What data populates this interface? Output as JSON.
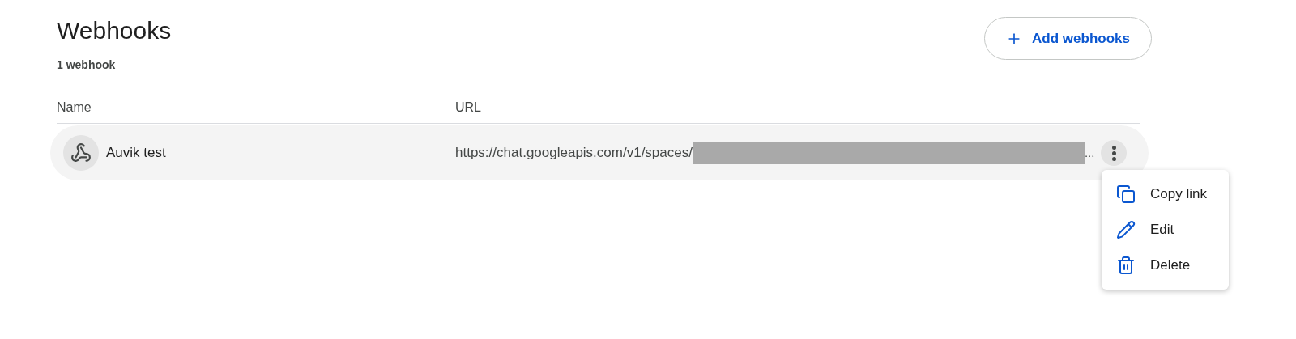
{
  "header": {
    "title": "Webhooks",
    "count": "1 webhook",
    "add_button": "Add webhooks"
  },
  "table": {
    "columns": [
      "Name",
      "URL"
    ],
    "rows": [
      {
        "name": "Auvik test",
        "url": "https://chat.googleapis.com/v1/spaces/",
        "ellipsis": "..."
      }
    ]
  },
  "menu": {
    "items": [
      {
        "kind": "copy",
        "label": "Copy link"
      },
      {
        "kind": "edit",
        "label": "Edit"
      },
      {
        "kind": "delete",
        "label": "Delete"
      }
    ]
  }
}
